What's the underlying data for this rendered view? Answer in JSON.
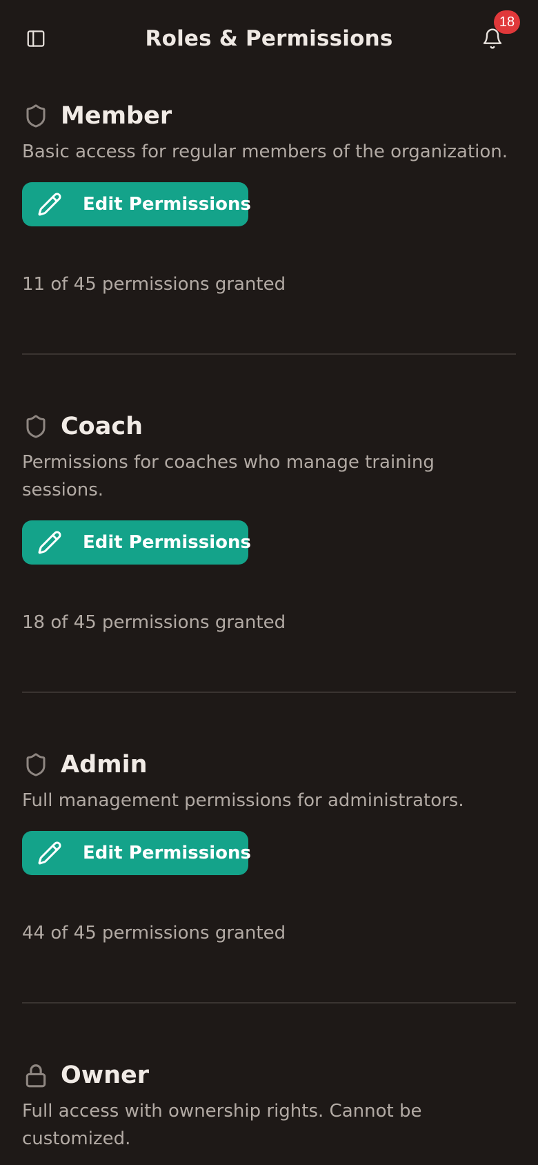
{
  "header": {
    "title": "Roles & Permissions",
    "sidebar_icon": "sidebar-panel-icon",
    "bell_icon": "bell-icon",
    "notification_count": "18"
  },
  "roles": [
    {
      "name": "Member",
      "icon": "shield-icon",
      "description": "Basic access for regular members of the organization.",
      "edit_label": "Edit Permissions",
      "granted": "11 of 45 permissions granted"
    },
    {
      "name": "Coach",
      "icon": "shield-icon",
      "description": "Permissions for coaches who manage training sessions.",
      "edit_label": "Edit Permissions",
      "granted": "18 of 45 permissions granted"
    },
    {
      "name": "Admin",
      "icon": "shield-icon",
      "description": "Full management permissions for administrators.",
      "edit_label": "Edit Permissions",
      "granted": "44 of 45 permissions granted"
    },
    {
      "name": "Owner",
      "icon": "lock-icon",
      "description": "Full access with ownership rights. Cannot be customized."
    }
  ],
  "colors": {
    "background": "#1e1917",
    "accent": "#14a38a",
    "badge": "#e0383a",
    "divider": "#3a3431",
    "muted_text": "#b2aaa4"
  }
}
